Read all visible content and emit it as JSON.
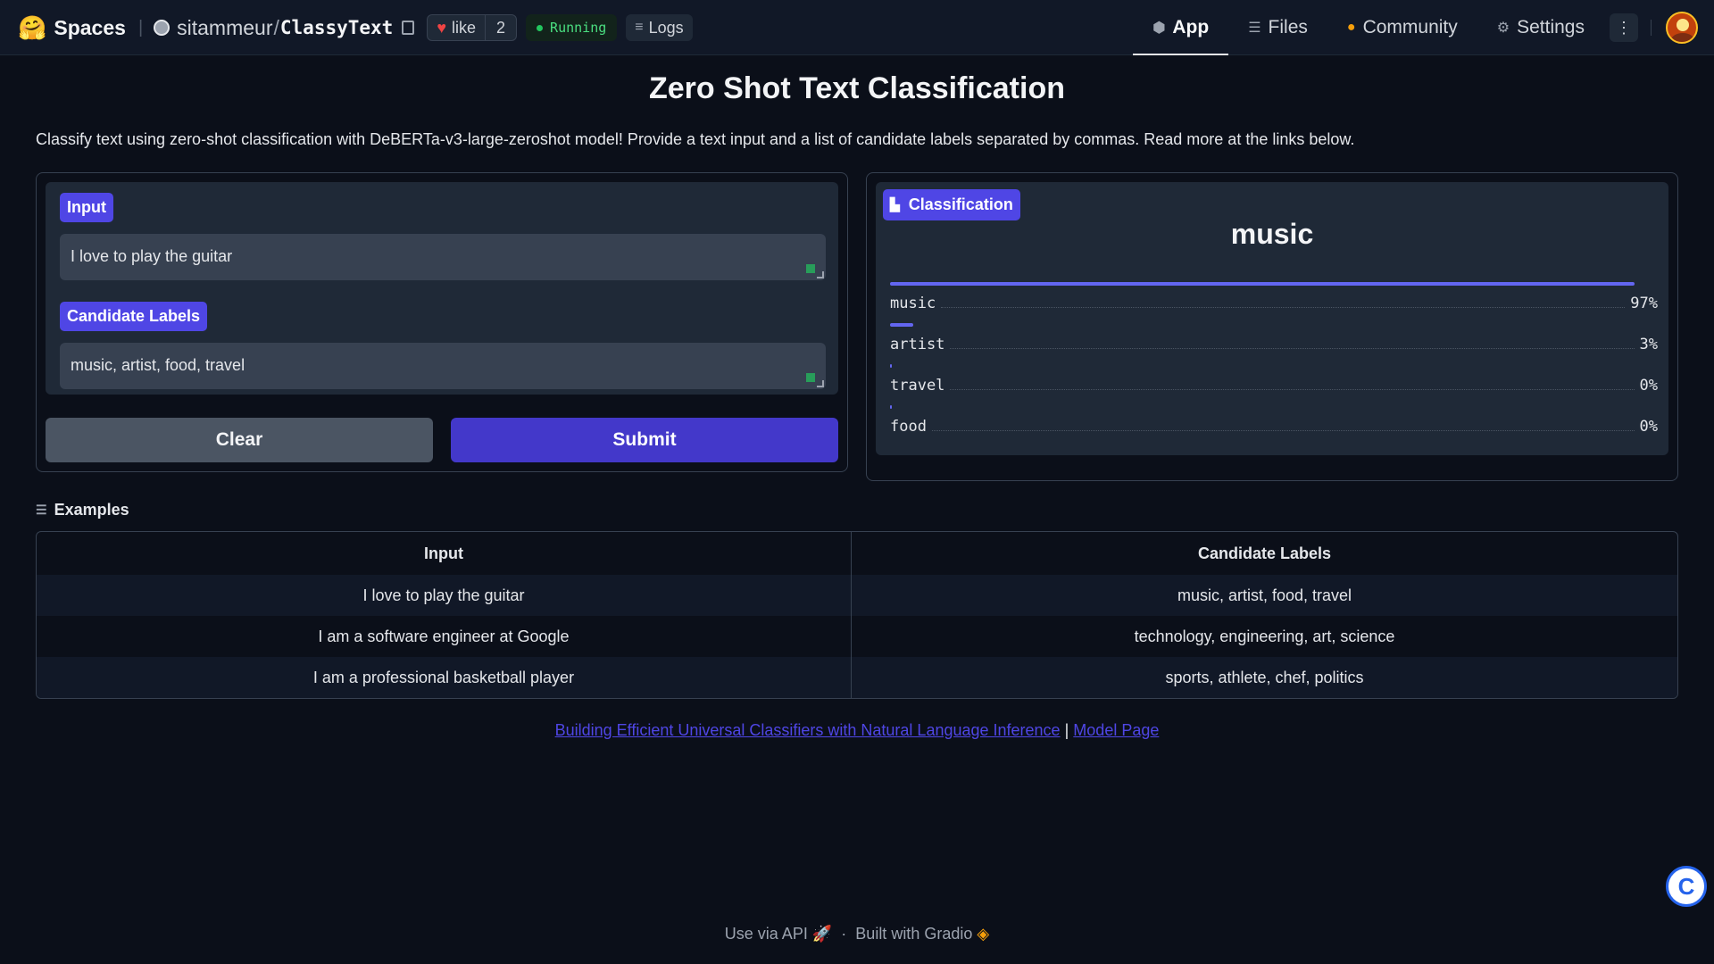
{
  "topbar": {
    "spaces_label": "Spaces",
    "repo_owner": "sitammeur",
    "repo_slash": "/",
    "repo_name": "ClassyText",
    "like_label": "like",
    "like_count": "2",
    "status": "Running",
    "logs_label": "Logs",
    "tabs": [
      {
        "label": "App",
        "icon": "app-cube-icon",
        "active": true
      },
      {
        "label": "Files",
        "icon": "files-icon",
        "active": false
      },
      {
        "label": "Community",
        "icon": "community-icon",
        "active": false
      },
      {
        "label": "Settings",
        "icon": "gear-icon",
        "active": false
      }
    ]
  },
  "main": {
    "title": "Zero Shot Text Classification",
    "description": "Classify text using zero-shot classification with DeBERTa-v3-large-zeroshot model! Provide a text input and a list of candidate labels separated by commas. Read more at the links below."
  },
  "form": {
    "input_label": "Input",
    "input_value": "I love to play the guitar",
    "labels_label": "Candidate Labels",
    "labels_value": "music, artist, food, travel",
    "clear_label": "Clear",
    "submit_label": "Submit"
  },
  "classification": {
    "chip_label": "Classification",
    "top_label": "music",
    "results": [
      {
        "label": "music",
        "pct": "97%",
        "value": 0.97
      },
      {
        "label": "artist",
        "pct": "3%",
        "value": 0.03
      },
      {
        "label": "travel",
        "pct": "0%",
        "value": 0.002
      },
      {
        "label": "food",
        "pct": "0%",
        "value": 0.001
      }
    ]
  },
  "examples": {
    "heading": "Examples",
    "headers": [
      "Input",
      "Candidate Labels"
    ],
    "rows": [
      [
        "I love to play the guitar",
        "music, artist, food, travel"
      ],
      [
        "I am a software engineer at Google",
        "technology, engineering, art, science"
      ],
      [
        "I am a professional basketball player",
        "sports, athlete, chef, politics"
      ]
    ]
  },
  "links": {
    "paper": "Building Efficient Universal Classifiers with Natural Language Inference",
    "separator": "|",
    "model": "Model Page"
  },
  "footer": {
    "api": "Use via API",
    "dot": "·",
    "built": "Built with Gradio"
  },
  "colors": {
    "accent": "#4f46e5",
    "bar": "#6366f1",
    "background": "#0b0f19",
    "running": "#4ade80"
  }
}
